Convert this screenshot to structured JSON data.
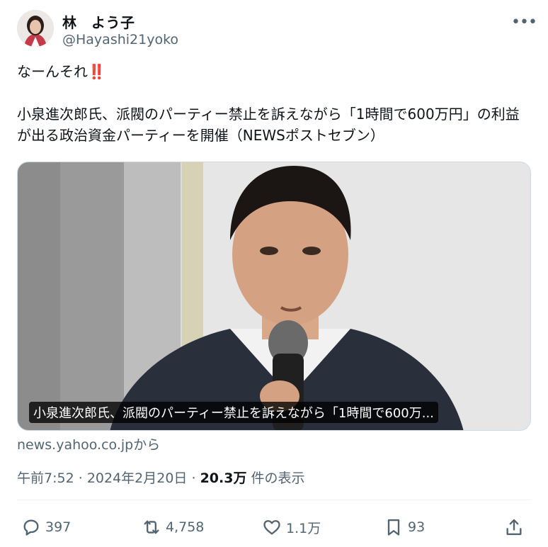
{
  "author": {
    "display_name": "林　よう子",
    "handle": "@Hayashi21yoko"
  },
  "more_icon": "more-horizontal-icon",
  "tweet": {
    "line1": "なーんそれ",
    "line1_emoji": "‼️",
    "body": "小泉進次郎氏、派閥のパーティー禁止を訴えながら「1時間で600万円」の利益が出る政治資金パーティーを開催（NEWSポストセブン）"
  },
  "link_card": {
    "caption": "小泉進次郎氏、派閥のパーティー禁止を訴えながら「1時間で600万...",
    "source": "news.yahoo.co.jpから"
  },
  "meta": {
    "time": "午前7:52",
    "separator": "·",
    "date": "2024年2月20日",
    "views_count": "20.3万",
    "views_label": "件の表示"
  },
  "actions": {
    "replies": "397",
    "reposts": "4,758",
    "likes": "1.1万",
    "bookmarks": "93"
  },
  "colors": {
    "text": "#0f1419",
    "secondary": "#536471",
    "border": "#cfd9de",
    "emoji_red": "#e0245e"
  }
}
